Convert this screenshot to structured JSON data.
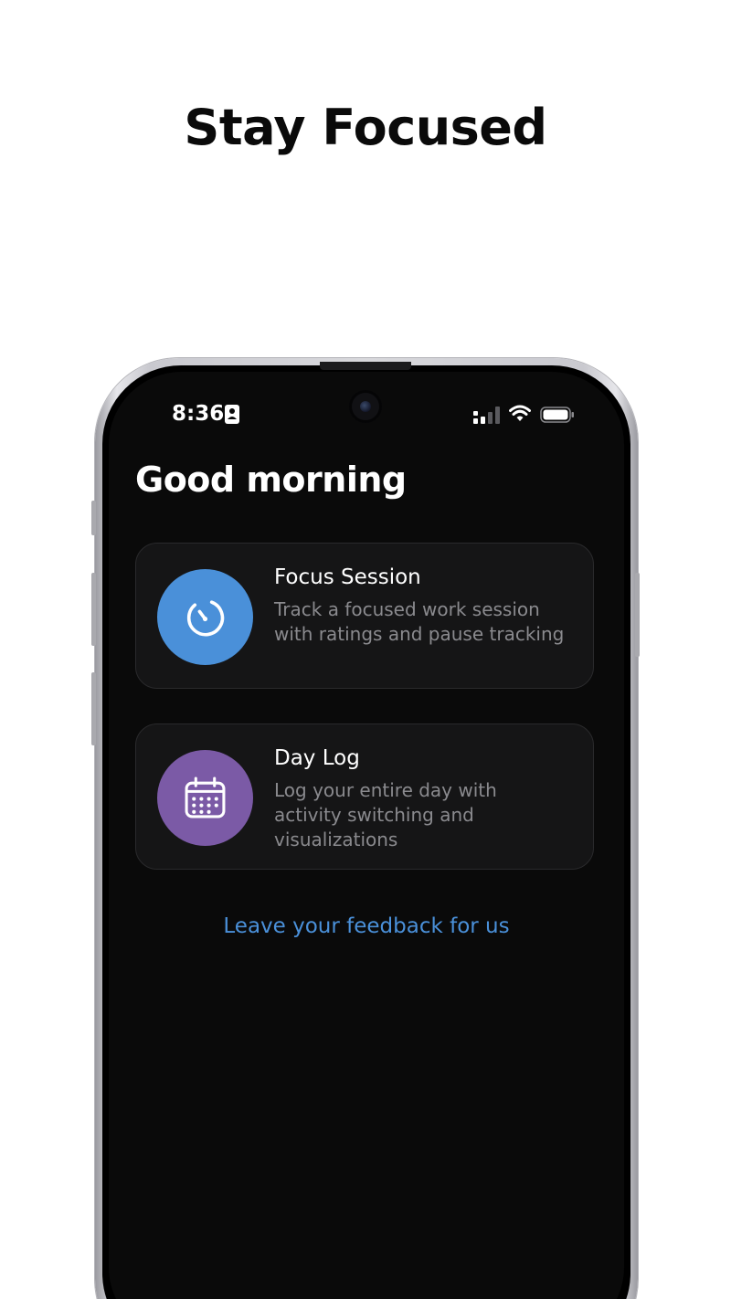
{
  "headline": "Stay Focused",
  "status_bar": {
    "time": "8:36",
    "icons": [
      "contact-card-icon",
      "cellular-signal-icon",
      "wifi-icon",
      "battery-icon"
    ]
  },
  "greeting": "Good morning",
  "cards": [
    {
      "title": "Focus Session",
      "description": "Track a focused work session with ratings and pause tracking",
      "icon": "timer-icon",
      "color": "#4a90d9"
    },
    {
      "title": "Day Log",
      "description": "Log your entire day with activity switching and visualizations",
      "icon": "calendar-icon",
      "color": "#7b5aa6"
    }
  ],
  "feedback_link": "Leave your feedback for us",
  "colors": {
    "screen_background": "#0a0a0a",
    "card_background": "#151516",
    "link": "#4a90d9",
    "secondary_text": "#8a8a8e"
  }
}
